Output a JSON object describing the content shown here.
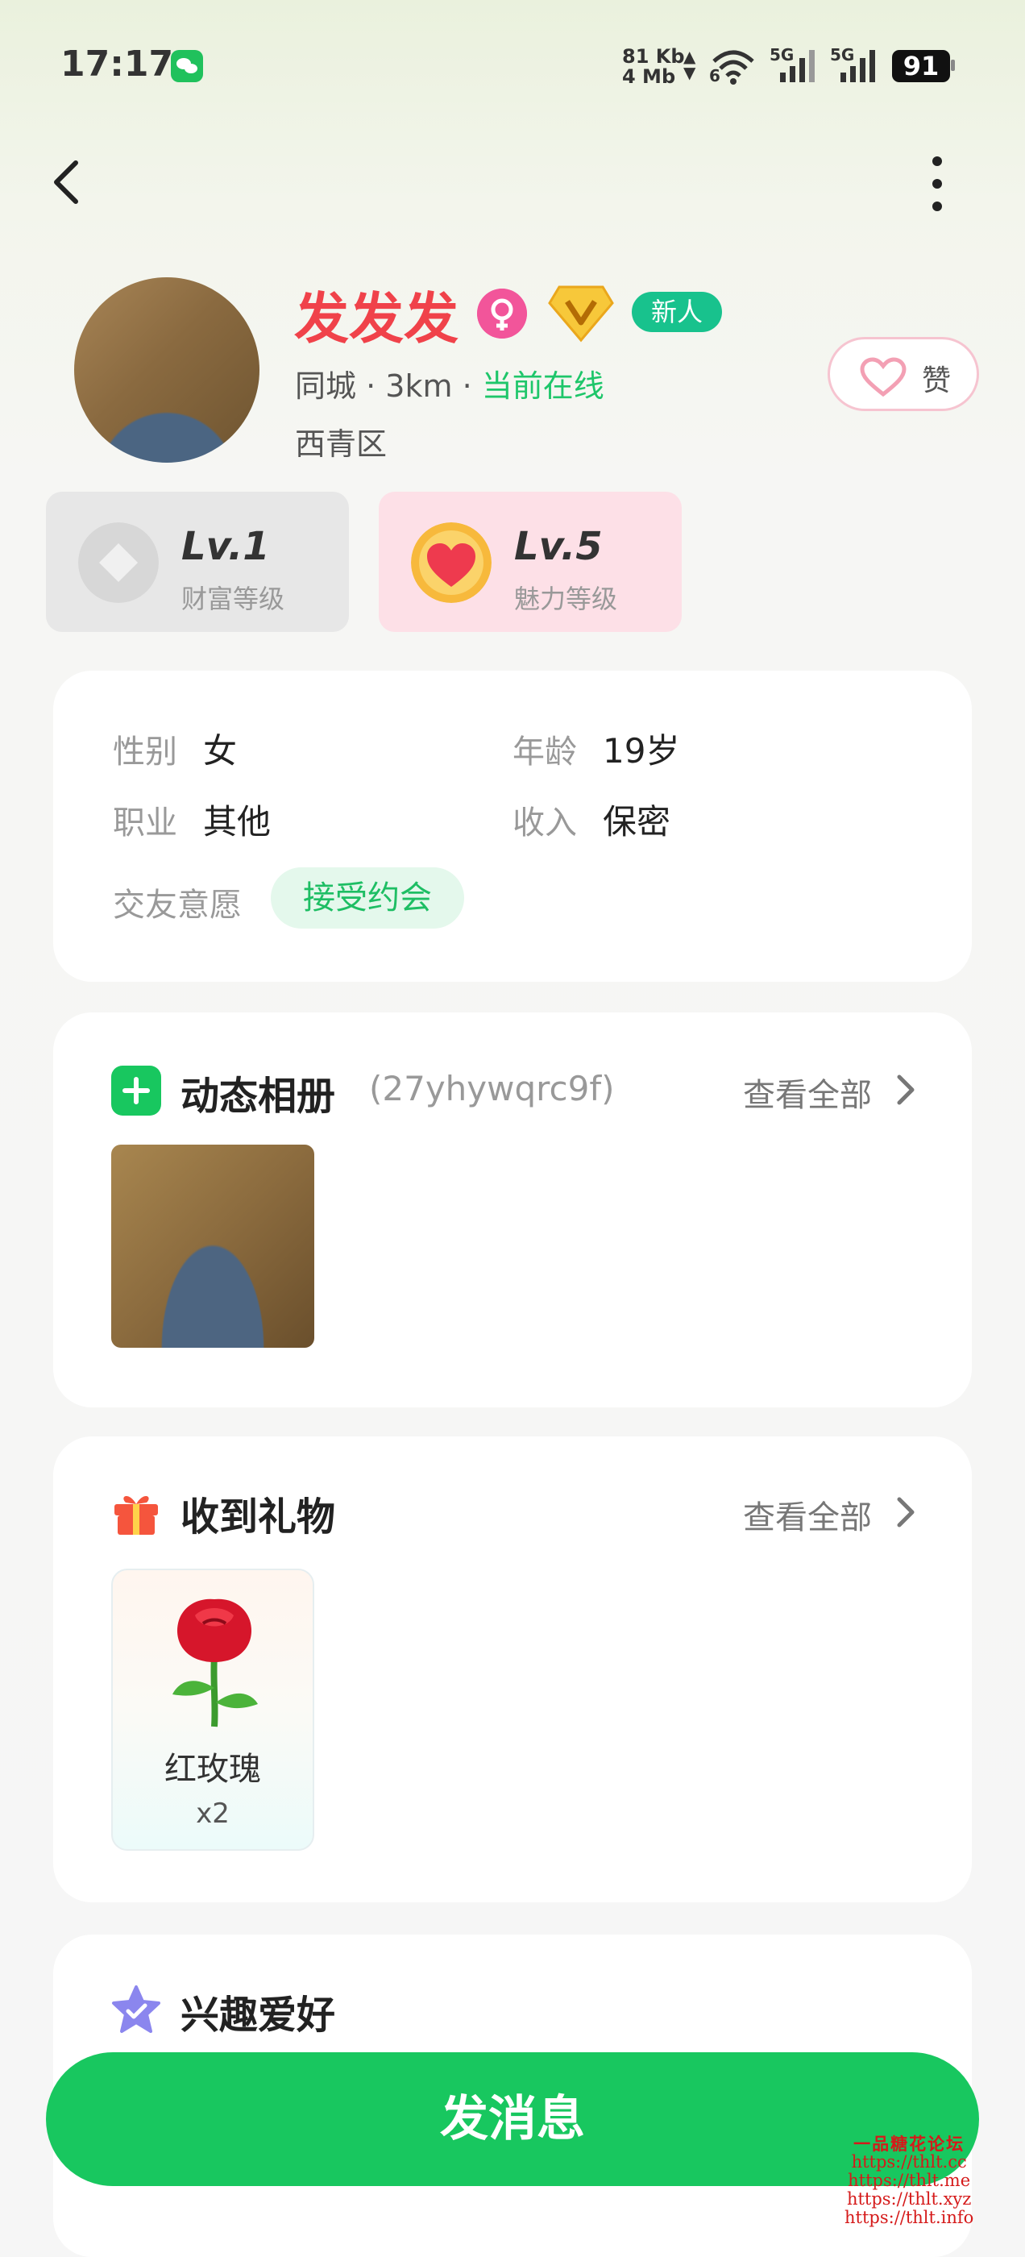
{
  "status_bar": {
    "time": "17:17",
    "net_speed_up": "81 Kb",
    "net_speed_down": "4 Mb",
    "wifi_number": "6",
    "signal_1_label": "5G",
    "signal_2_label": "5G",
    "battery": "91",
    "icons": [
      "wechat-icon",
      "wifi-icon",
      "signal-icon",
      "signal-icon",
      "battery-icon"
    ]
  },
  "header": {
    "back_icon": "chevron-left-icon",
    "more_icon": "more-vertical-icon"
  },
  "profile": {
    "nickname": "发发发",
    "new_badge": "新人",
    "location_type": "同城",
    "distance": "3km",
    "online_status": "当前在线",
    "district": "西青区",
    "like_label": "赞",
    "colors": {
      "nickname": "#f0424a",
      "online": "#1ec66a",
      "new_badge": "#18c28d"
    }
  },
  "levels": [
    {
      "value": "Lv.1",
      "label": "财富等级"
    },
    {
      "value": "Lv.5",
      "label": "魅力等级"
    }
  ],
  "info": {
    "gender_label": "性别",
    "gender_value": "女",
    "age_label": "年龄",
    "age_value": "19岁",
    "job_label": "职业",
    "job_value": "其他",
    "income_label": "收入",
    "income_value": "保密",
    "intent_label": "交友意愿",
    "intent_value": "接受约会"
  },
  "album": {
    "title": "动态相册",
    "id": "(27yhywqrc9f)",
    "view_all": "查看全部"
  },
  "gifts": {
    "title": "收到礼物",
    "view_all": "查看全部",
    "items": [
      {
        "name": "红玫瑰",
        "count": "x2",
        "icon": "rose-icon"
      }
    ]
  },
  "hobbies": {
    "title": "兴趣爱好"
  },
  "send_button": "发消息",
  "watermark": [
    "一品糖花论坛",
    "https://thlt.cc",
    "https://thlt.me",
    "https://thlt.xyz",
    "https://thlt.info"
  ],
  "theme": {
    "primary_green": "#18c75f"
  }
}
